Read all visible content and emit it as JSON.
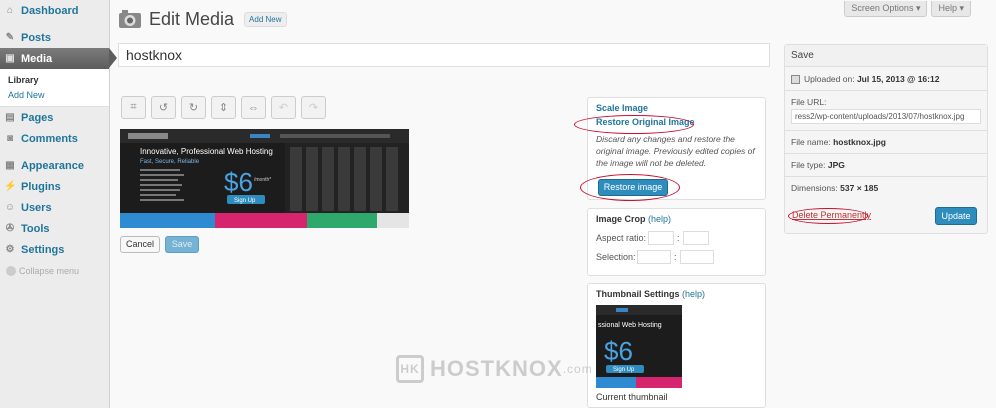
{
  "sidebar": {
    "items": [
      {
        "label": "Dashboard",
        "icon": "dashboard-icon"
      },
      {
        "label": "Posts",
        "icon": "pin-icon"
      },
      {
        "label": "Media",
        "icon": "media-icon"
      },
      {
        "label": "Pages",
        "icon": "page-icon"
      },
      {
        "label": "Comments",
        "icon": "comment-icon"
      },
      {
        "label": "Appearance",
        "icon": "brush-icon"
      },
      {
        "label": "Plugins",
        "icon": "plug-icon"
      },
      {
        "label": "Users",
        "icon": "user-icon"
      },
      {
        "label": "Tools",
        "icon": "wrench-icon"
      },
      {
        "label": "Settings",
        "icon": "settings-icon"
      }
    ],
    "media_sub": [
      "Library",
      "Add New"
    ],
    "collapse": "Collapse menu"
  },
  "topbar": {
    "screen_options": "Screen Options ▾",
    "help": "Help ▾"
  },
  "header": {
    "title": "Edit Media",
    "add_new": "Add New"
  },
  "title_value": "hostknox",
  "actions": {
    "cancel": "Cancel",
    "save": "Save"
  },
  "restore": {
    "scale": "Scale Image",
    "restore_original": "Restore Original Image",
    "desc": "Discard any changes and restore the original image. Previously edited copies of the image will not be deleted.",
    "button": "Restore image"
  },
  "crop": {
    "title": "Image Crop",
    "help": "(help)",
    "aspect": "Aspect ratio:",
    "selection": "Selection:",
    "sep": ":"
  },
  "thumb": {
    "title": "Thumbnail Settings",
    "help": "(help)",
    "current": "Current thumbnail"
  },
  "savebox": {
    "title": "Save",
    "uploaded_label": "Uploaded on:",
    "uploaded_value": "Jul 15, 2013 @ 16:12",
    "file_url_label": "File URL:",
    "file_url": "ress2/wp-content/uploads/2013/07/hostknox.jpg",
    "file_name_label": "File name:",
    "file_name": "hostknox.jpg",
    "file_type_label": "File type:",
    "file_type": "JPG",
    "dimensions_label": "Dimensions:",
    "dimensions": "537 × 185",
    "delete": "Delete Permanently",
    "update": "Update"
  },
  "preview": {
    "headline": "Innovative, Professional Web Hosting",
    "tagline": "Fast, Secure, Reliable",
    "price": "$6",
    "per": "/month*",
    "cta": "Sign Up",
    "thumb_headline": "ssional Web Hosting"
  },
  "watermark": {
    "text": "HOSTKNOX",
    "suffix": ".com"
  }
}
